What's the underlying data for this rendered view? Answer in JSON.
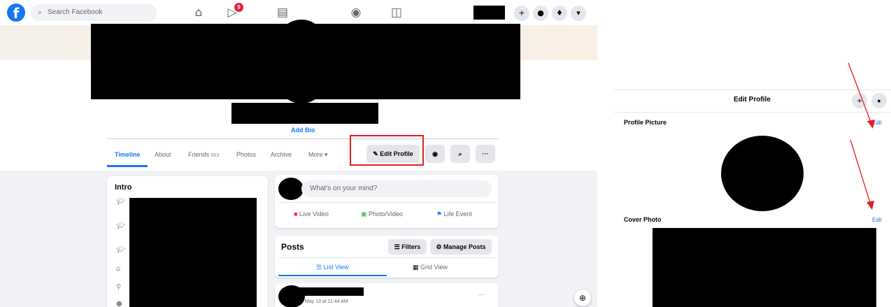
{
  "topbar": {
    "logo_letter": "f",
    "search_placeholder": "Search Facebook",
    "watch_badge": "9",
    "plus_glyph": "+",
    "icons": [
      "home-icon",
      "watch-icon",
      "marketplace-icon",
      "groups-icon",
      "gaming-icon",
      "plus-icon",
      "messenger-icon",
      "bell-icon",
      "caret-down-icon"
    ]
  },
  "profile": {
    "add_bio": "Add Bio",
    "tabs": [
      {
        "label": "Timeline"
      },
      {
        "label": "About"
      },
      {
        "label": "Friends",
        "count": "663"
      },
      {
        "label": "Photos"
      },
      {
        "label": "Archive"
      },
      {
        "label": "More ▾"
      }
    ],
    "edit_profile": "Edit Profile",
    "more_dots": "···"
  },
  "intro": {
    "title": "Intro"
  },
  "composer": {
    "placeholder": "What's on your mind?",
    "actions": [
      "Live Video",
      "Photo/Video",
      "Life Event"
    ]
  },
  "posts": {
    "title": "Posts",
    "filters": "Filters",
    "manage": "Manage Posts",
    "list_view": "List View",
    "grid_view": "Grid View",
    "timestamp": "May 13 at 11:44 AM",
    "dots": "···"
  },
  "edit_panel": {
    "title": "Edit Profile",
    "profile_picture": "Profile Picture",
    "cover_photo": "Cover Photo",
    "edit": "Edit",
    "plus_glyph": "+"
  },
  "colors": {
    "accent": "#1877f2",
    "annotation": "#e41e1e",
    "badge": "#e41e3f"
  }
}
